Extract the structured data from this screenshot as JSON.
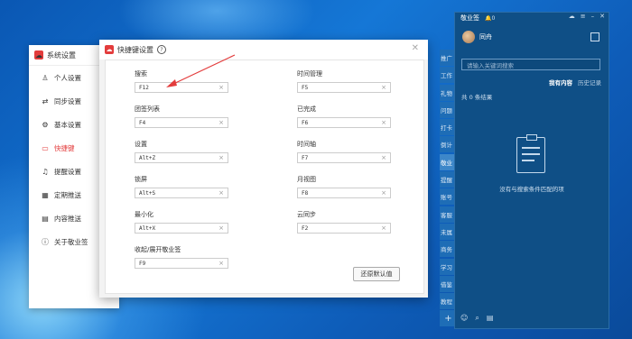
{
  "system_window": {
    "title": "系统设置",
    "nav": [
      {
        "label": "个人设置",
        "icon": "user-icon"
      },
      {
        "label": "同步设置",
        "icon": "sync-icon"
      },
      {
        "label": "基本设置",
        "icon": "gear-icon"
      },
      {
        "label": "快捷键",
        "icon": "keyboard-icon",
        "active": true
      },
      {
        "label": "提醒设置",
        "icon": "bell-icon"
      },
      {
        "label": "定期推送",
        "icon": "schedule-icon"
      },
      {
        "label": "内容推送",
        "icon": "content-icon"
      },
      {
        "label": "关于敬业签",
        "icon": "info-icon"
      }
    ]
  },
  "shortcut_dialog": {
    "title": "快捷键设置",
    "fields": [
      {
        "label": "搜索",
        "value": "F12"
      },
      {
        "label": "时间管理",
        "value": "F5"
      },
      {
        "label": "团签列表",
        "value": "F4"
      },
      {
        "label": "已完成",
        "value": "F6"
      },
      {
        "label": "设置",
        "value": "Alt+Z"
      },
      {
        "label": "时间轴",
        "value": "F7"
      },
      {
        "label": "锁屏",
        "value": "Alt+S"
      },
      {
        "label": "月视图",
        "value": "F8"
      },
      {
        "label": "最小化",
        "value": "Alt+X"
      },
      {
        "label": "云同步",
        "value": "F2"
      },
      {
        "label": "收起/展开敬业签",
        "value": "F9"
      }
    ],
    "restore_label": "还原默认值"
  },
  "side_tabs": [
    "推广",
    "工作",
    "礼物",
    "问题",
    "打卡",
    "倒计",
    "敬业",
    "提醒",
    "账号",
    "客服",
    "未属",
    "商务",
    "学习",
    "借鉴",
    "教程"
  ],
  "side_tabs_active_index": 6,
  "app": {
    "title": "敬业签",
    "bell_count": "0",
    "username": "同舟",
    "search_placeholder": "请输入关键词搜索",
    "filter_active": "我有内容",
    "filter_history": "历史记录",
    "count_text": "共 0 条结果",
    "empty_text": "没有与搜索条件匹配的项"
  },
  "colors": {
    "accent": "#e33c3c",
    "app_bg": "#0f4f86",
    "desktop": "#1577d6"
  }
}
